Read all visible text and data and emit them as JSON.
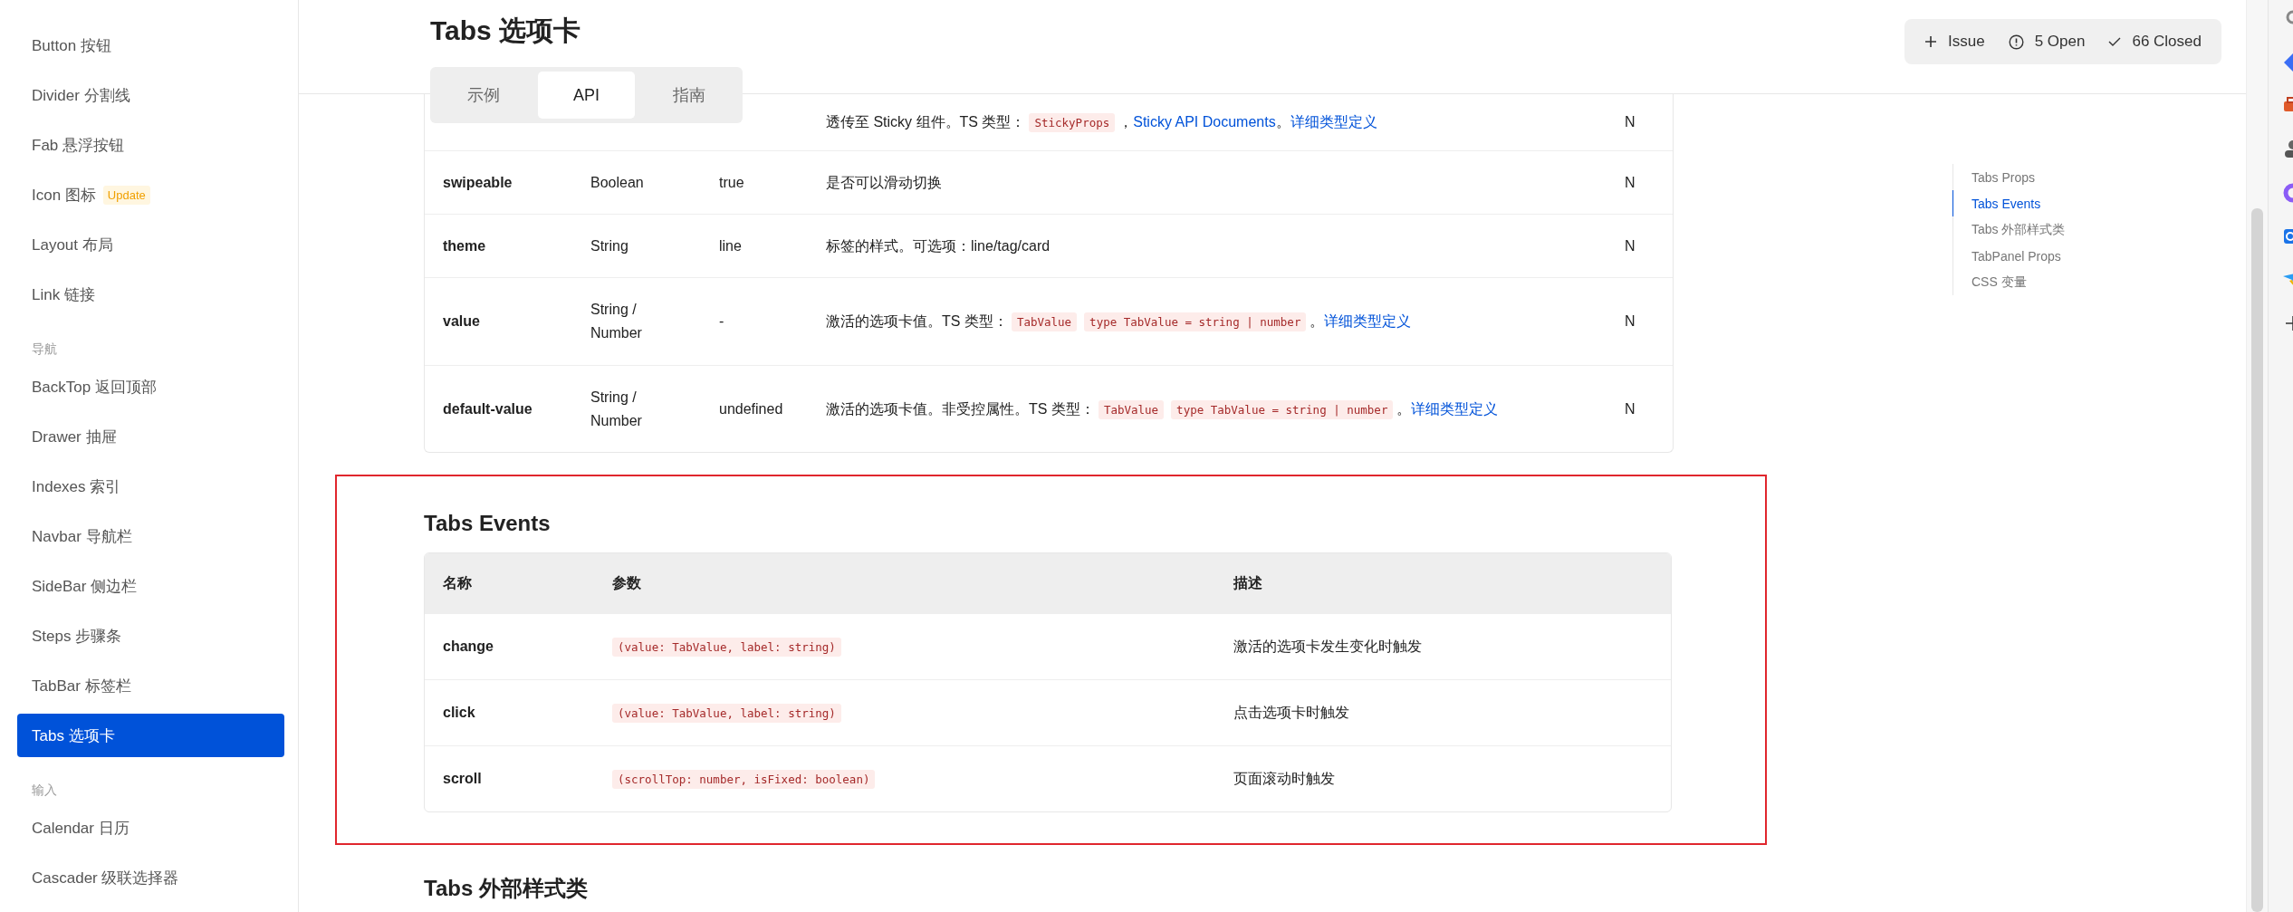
{
  "sidebar": {
    "groups": [
      {
        "items": [
          {
            "label": "Button 按钮",
            "selected": false
          },
          {
            "label": "Divider 分割线",
            "selected": false
          },
          {
            "label": "Fab 悬浮按钮",
            "selected": false
          },
          {
            "label": "Icon 图标",
            "badge": "Update",
            "selected": false
          },
          {
            "label": "Layout 布局",
            "selected": false
          },
          {
            "label": "Link 链接",
            "selected": false
          }
        ]
      },
      {
        "title": "导航",
        "items": [
          {
            "label": "BackTop 返回顶部",
            "selected": false
          },
          {
            "label": "Drawer 抽屉",
            "selected": false
          },
          {
            "label": "Indexes 索引",
            "selected": false
          },
          {
            "label": "Navbar 导航栏",
            "selected": false
          },
          {
            "label": "SideBar 侧边栏",
            "selected": false
          },
          {
            "label": "Steps 步骤条",
            "selected": false
          },
          {
            "label": "TabBar 标签栏",
            "selected": false
          },
          {
            "label": "Tabs 选项卡",
            "selected": true
          }
        ]
      },
      {
        "title": "输入",
        "items": [
          {
            "label": "Calendar 日历",
            "selected": false
          },
          {
            "label": "Cascader 级联选择器",
            "selected": false
          }
        ]
      }
    ]
  },
  "page": {
    "title": "Tabs 选项卡",
    "tabs": [
      {
        "label": "示例",
        "selected": false
      },
      {
        "label": "API",
        "selected": true
      },
      {
        "label": "指南",
        "selected": false
      }
    ]
  },
  "issues": [
    {
      "kind": "add",
      "label": "Issue"
    },
    {
      "kind": "open",
      "label": "5 Open"
    },
    {
      "kind": "closed",
      "label": "66 Closed"
    }
  ],
  "props_table": {
    "rows": [
      {
        "description": [
          {
            "kind": "text",
            "text": "透传至 Sticky 组件。TS 类型："
          },
          {
            "kind": "code",
            "text": "StickyProps"
          },
          {
            "kind": "text",
            "text": "，"
          },
          {
            "kind": "link",
            "text": "Sticky API Documents"
          },
          {
            "kind": "text",
            "text": "。"
          },
          {
            "kind": "link",
            "text": "详细类型定义"
          }
        ],
        "required": "N"
      },
      {
        "name": "swipeable",
        "type": "Boolean",
        "default": "true",
        "description": [
          {
            "kind": "text",
            "text": "是否可以滑动切换"
          }
        ],
        "required": "N"
      },
      {
        "name": "theme",
        "type": "String",
        "default": "line",
        "description": [
          {
            "kind": "text",
            "text": "标签的样式。可选项：line/tag/card"
          }
        ],
        "required": "N"
      },
      {
        "name": "value",
        "type": "String / Number",
        "default": "-",
        "description": [
          {
            "kind": "text",
            "text": "激活的选项卡值。TS 类型："
          },
          {
            "kind": "code",
            "text": "TabValue"
          },
          {
            "kind": "code",
            "text": "type TabValue = string | number"
          },
          {
            "kind": "text",
            "text": "。"
          },
          {
            "kind": "link",
            "text": "详细类型定义"
          }
        ],
        "required": "N"
      },
      {
        "name": "default-value",
        "type": "String / Number",
        "default": "undefined",
        "description": [
          {
            "kind": "text",
            "text": "激活的选项卡值。非受控属性。TS 类型："
          },
          {
            "kind": "code",
            "text": "TabValue"
          },
          {
            "kind": "code",
            "text": "type TabValue = string | number"
          },
          {
            "kind": "text",
            "text": "。"
          },
          {
            "kind": "link",
            "text": "详细类型定义"
          }
        ],
        "required": "N"
      }
    ]
  },
  "events": {
    "title": "Tabs Events",
    "columns": [
      "名称",
      "参数",
      "描述"
    ],
    "rows": [
      {
        "name": "change",
        "params": "(value: TabValue, label: string)",
        "description": "激活的选项卡发生变化时触发"
      },
      {
        "name": "click",
        "params": "(value: TabValue, label: string)",
        "description": "点击选项卡时触发"
      },
      {
        "name": "scroll",
        "params": "(scrollTop: number, isFixed: boolean)",
        "description": "页面滚动时触发"
      }
    ]
  },
  "next_section": {
    "title": "Tabs 外部样式类"
  },
  "toc": [
    {
      "label": "Tabs Props",
      "selected": false
    },
    {
      "label": "Tabs Events",
      "selected": true
    },
    {
      "label": "Tabs 外部样式类",
      "selected": false
    },
    {
      "label": "TabPanel Props",
      "selected": false
    },
    {
      "label": "CSS 变量",
      "selected": false
    }
  ]
}
